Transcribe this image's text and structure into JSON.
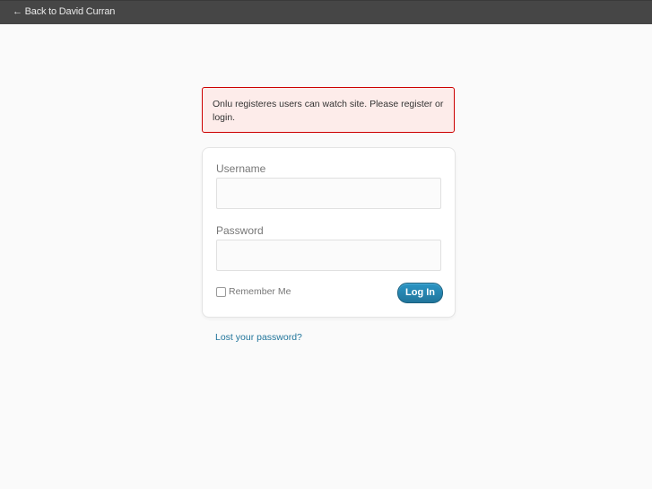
{
  "topbar": {
    "back_link": "← Back to David Curran"
  },
  "error": {
    "message": "Onlu registeres users can watch site. Please register or login."
  },
  "form": {
    "username_label": "Username",
    "username_value": "",
    "password_label": "Password",
    "password_value": "",
    "remember_label": "Remember Me",
    "remember_checked": false,
    "submit_label": "Log In"
  },
  "links": {
    "lost_password": "Lost your password?"
  },
  "colors": {
    "topbar_bg": "#464646",
    "error_border": "#cc0000",
    "button_bg": "#21759b",
    "link": "#21759b",
    "page_bg": "#fafafa"
  }
}
